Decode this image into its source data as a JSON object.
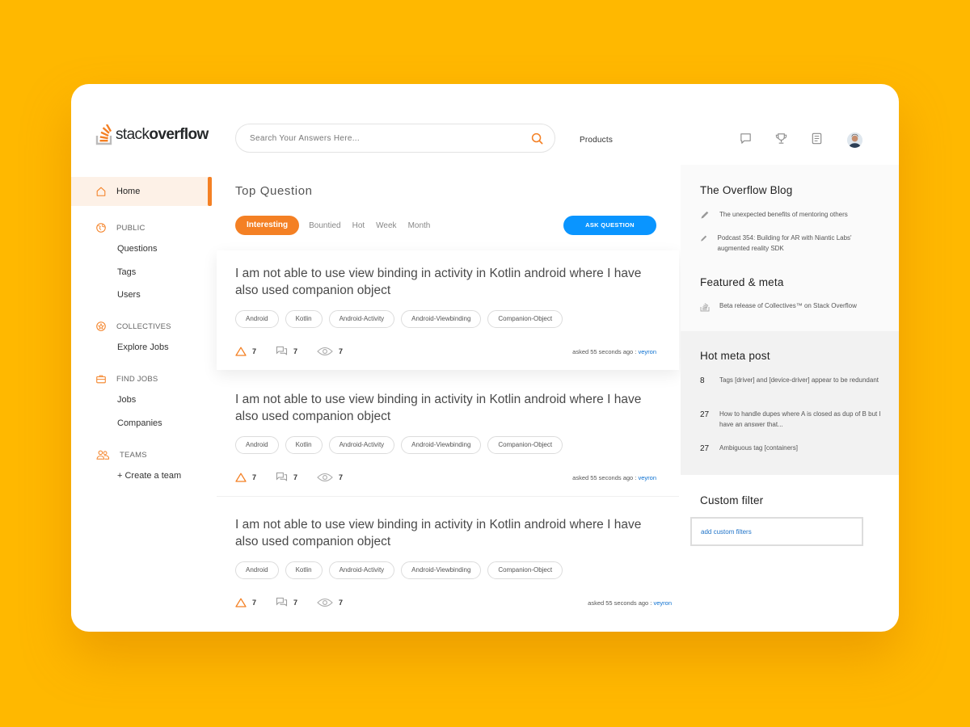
{
  "logo": {
    "part1": "stack",
    "part2": "overflow"
  },
  "search": {
    "placeholder": "Search Your Answers Here..."
  },
  "header": {
    "products_label": "Products"
  },
  "sidebar": {
    "home": "Home",
    "sections": [
      {
        "label": "PUBLIC",
        "items": [
          "Questions",
          "Tags",
          "Users"
        ]
      },
      {
        "label": "COLLECTIVES",
        "items": [
          "Explore Jobs"
        ]
      },
      {
        "label": "FIND JOBS",
        "items": [
          "Jobs",
          "Companies"
        ]
      },
      {
        "label": "TEAMS",
        "items": [
          "+ Create a team"
        ]
      }
    ]
  },
  "main": {
    "title": "Top Question",
    "filters": [
      "Interesting",
      "Bountied",
      "Hot",
      "Week",
      "Month"
    ],
    "ask_button": "ASK QUESTION",
    "questions": [
      {
        "title": "I am not able to use view binding in activity in Kotlin android where I have also used companion object",
        "tags": [
          "Android",
          "Kotlin",
          "Android-Activity",
          "Android-Viewbinding",
          "Companion-Object"
        ],
        "votes": "7",
        "answers": "7",
        "views": "7",
        "asked": "asked 55 seconds ago :",
        "user": "veyron"
      },
      {
        "title": "I am not able to use view binding in activity in Kotlin android where I have also used companion object",
        "tags": [
          "Android",
          "Kotlin",
          "Android-Activity",
          "Android-Viewbinding",
          "Companion-Object"
        ],
        "votes": "7",
        "answers": "7",
        "views": "7",
        "asked": "asked 55 seconds ago :",
        "user": "veyron"
      },
      {
        "title": "I am not able to use view binding in activity in Kotlin android where I have also used companion object",
        "tags": [
          "Android",
          "Kotlin",
          "Android-Activity",
          "Android-Viewbinding",
          "Companion-Object"
        ],
        "votes": "7",
        "answers": "7",
        "views": "7",
        "asked": "asked 55 seconds ago :",
        "user": "veyron"
      }
    ]
  },
  "right": {
    "blog_title": "The Overflow Blog",
    "blog_items": [
      "The unexpected benefits of mentoring others",
      "Podcast 354: Building for AR with Niantic Labs' augmented reality SDK"
    ],
    "featured_title": "Featured & meta",
    "featured_items": [
      "Beta release of Collectives™ on Stack Overflow"
    ],
    "hot_title": "Hot meta post",
    "hot_items": [
      {
        "count": "8",
        "text": "Tags [driver] and [device-driver] appear to be redundant"
      },
      {
        "count": "27",
        "text": "How to handle dupes where A is closed as dup of B but I have an answer that..."
      },
      {
        "count": "27",
        "text": "Ambiguous tag [containers]"
      }
    ],
    "custom_filter_title": "Custom filter",
    "custom_filter_link": "add custom filters"
  },
  "colors": {
    "background": "#FFB800",
    "accent": "#F48024",
    "primary_button": "#0A95FF",
    "link": "#0A6FD0"
  }
}
